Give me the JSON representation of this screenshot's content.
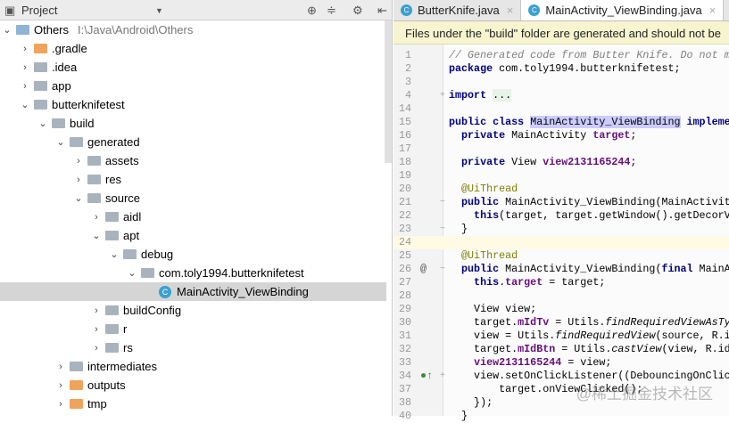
{
  "project": {
    "title": "Project",
    "icons": [
      "target-icon",
      "collapse-icon",
      "gear-icon",
      "hide-icon"
    ]
  },
  "tree": [
    {
      "label": "Others",
      "path": "I:\\Java\\Android\\Others",
      "level": 0,
      "arrow": "⌄",
      "kind": "module"
    },
    {
      "label": ".gradle",
      "level": 1,
      "arrow": "›",
      "kind": "o"
    },
    {
      "label": ".idea",
      "level": 1,
      "arrow": "›",
      "kind": "g"
    },
    {
      "label": "app",
      "level": 1,
      "arrow": "›",
      "kind": "g"
    },
    {
      "label": "butterknifetest",
      "level": 1,
      "arrow": "⌄",
      "kind": "g"
    },
    {
      "label": "build",
      "level": 2,
      "arrow": "⌄",
      "kind": "g"
    },
    {
      "label": "generated",
      "level": 3,
      "arrow": "⌄",
      "kind": "g"
    },
    {
      "label": "assets",
      "level": 4,
      "arrow": "›",
      "kind": "g"
    },
    {
      "label": "res",
      "level": 4,
      "arrow": "›",
      "kind": "g"
    },
    {
      "label": "source",
      "level": 4,
      "arrow": "⌄",
      "kind": "g"
    },
    {
      "label": "aidl",
      "level": 5,
      "arrow": "›",
      "kind": "g"
    },
    {
      "label": "apt",
      "level": 5,
      "arrow": "⌄",
      "kind": "g"
    },
    {
      "label": "debug",
      "level": 6,
      "arrow": "⌄",
      "kind": "g"
    },
    {
      "label": "com.toly1994.butterknifetest",
      "level": 7,
      "arrow": "⌄",
      "kind": "g"
    },
    {
      "label": "MainActivity_ViewBinding",
      "level": 8,
      "arrow": "",
      "kind": "class",
      "selected": true
    },
    {
      "label": "buildConfig",
      "level": 5,
      "arrow": "›",
      "kind": "g"
    },
    {
      "label": "r",
      "level": 5,
      "arrow": "›",
      "kind": "g"
    },
    {
      "label": "rs",
      "level": 5,
      "arrow": "›",
      "kind": "g"
    },
    {
      "label": "intermediates",
      "level": 3,
      "arrow": "›",
      "kind": "g"
    },
    {
      "label": "outputs",
      "level": 3,
      "arrow": "›",
      "kind": "o"
    },
    {
      "label": "tmp",
      "level": 3,
      "arrow": "›",
      "kind": "o"
    }
  ],
  "tabs": [
    {
      "label": "ButterKnife.java",
      "active": false
    },
    {
      "label": "MainActivity_ViewBinding.java",
      "active": true
    }
  ],
  "notice": "Files under the \"build\" folder are generated and should not be",
  "code": [
    {
      "n": "1",
      "t": [
        [
          "// Generated code from Butter Knife. Do not m",
          "cm"
        ]
      ]
    },
    {
      "n": "2",
      "t": [
        [
          "package",
          "kw"
        ],
        [
          " com.toly1994.butterknifetest;",
          ""
        ]
      ]
    },
    {
      "n": "3",
      "t": []
    },
    {
      "n": "4",
      "f": "+",
      "t": [
        [
          "import",
          "kw"
        ],
        [
          " ",
          ""
        ],
        [
          "...",
          "fd"
        ]
      ]
    },
    {
      "n": "14",
      "t": []
    },
    {
      "n": "15",
      "t": [
        [
          "public class",
          "kw"
        ],
        [
          " ",
          ""
        ],
        [
          "MainActivity_ViewBinding",
          "hl"
        ],
        [
          " impleme",
          "kw"
        ]
      ]
    },
    {
      "n": "16",
      "t": [
        [
          "  private",
          "kw"
        ],
        [
          " MainActivity ",
          ""
        ],
        [
          "target",
          "fld"
        ],
        [
          ";",
          ""
        ]
      ]
    },
    {
      "n": "17",
      "t": []
    },
    {
      "n": "18",
      "t": [
        [
          "  private",
          "kw"
        ],
        [
          " View ",
          ""
        ],
        [
          "view2131165244",
          "fld"
        ],
        [
          ";",
          ""
        ]
      ]
    },
    {
      "n": "19",
      "t": []
    },
    {
      "n": "20",
      "t": [
        [
          "  @UiThread",
          "ann"
        ]
      ]
    },
    {
      "n": "21",
      "f": "−",
      "t": [
        [
          "  public",
          "kw"
        ],
        [
          " MainActivity_ViewBinding(MainActivit",
          ""
        ]
      ]
    },
    {
      "n": "22",
      "t": [
        [
          "    this",
          "kw"
        ],
        [
          "(target, target.getWindow().getDecorV",
          ""
        ]
      ]
    },
    {
      "n": "23",
      "f": "−",
      "t": [
        [
          "  }",
          ""
        ]
      ]
    },
    {
      "n": "24",
      "cur": true,
      "t": []
    },
    {
      "n": "25",
      "t": [
        [
          "  @UiThread",
          "ann"
        ]
      ]
    },
    {
      "n": "26",
      "g": "@",
      "f": "−",
      "t": [
        [
          "  public",
          "kw"
        ],
        [
          " MainActivity_ViewBinding(",
          ""
        ],
        [
          "final",
          "kw"
        ],
        [
          " MainA",
          ""
        ]
      ]
    },
    {
      "n": "27",
      "t": [
        [
          "    this",
          "kw"
        ],
        [
          ".",
          ""
        ],
        [
          "target",
          "fld"
        ],
        [
          " = target;",
          ""
        ]
      ]
    },
    {
      "n": "28",
      "t": []
    },
    {
      "n": "29",
      "t": [
        [
          "    View view;",
          ""
        ]
      ]
    },
    {
      "n": "30",
      "t": [
        [
          "    target.",
          ""
        ],
        [
          "mIdTv",
          "fld"
        ],
        [
          " = Utils.",
          ""
        ],
        [
          "findRequiredViewAsTy",
          "it"
        ]
      ]
    },
    {
      "n": "31",
      "t": [
        [
          "    view = Utils.",
          ""
        ],
        [
          "findRequiredView",
          "it"
        ],
        [
          "(source, R.i",
          ""
        ]
      ]
    },
    {
      "n": "32",
      "t": [
        [
          "    target.",
          ""
        ],
        [
          "mIdBtn",
          "fld"
        ],
        [
          " = Utils.",
          ""
        ],
        [
          "castView",
          "it"
        ],
        [
          "(view, R.id",
          ""
        ]
      ]
    },
    {
      "n": "33",
      "t": [
        [
          "    ",
          ""
        ],
        [
          "view2131165244",
          "fld"
        ],
        [
          " = view;",
          ""
        ]
      ]
    },
    {
      "n": "34",
      "g": "●↑",
      "f": "+",
      "t": [
        [
          "    view.setOnClickListener((DebouncingOnClic",
          ""
        ]
      ]
    },
    {
      "n": "37",
      "t": [
        [
          "        target.onViewClicked();",
          ""
        ]
      ]
    },
    {
      "n": "38",
      "t": [
        [
          "    });",
          ""
        ]
      ]
    },
    {
      "n": "40",
      "t": [
        [
          "  }",
          ""
        ]
      ]
    }
  ],
  "watermark": "@稀土掘金技术社区"
}
